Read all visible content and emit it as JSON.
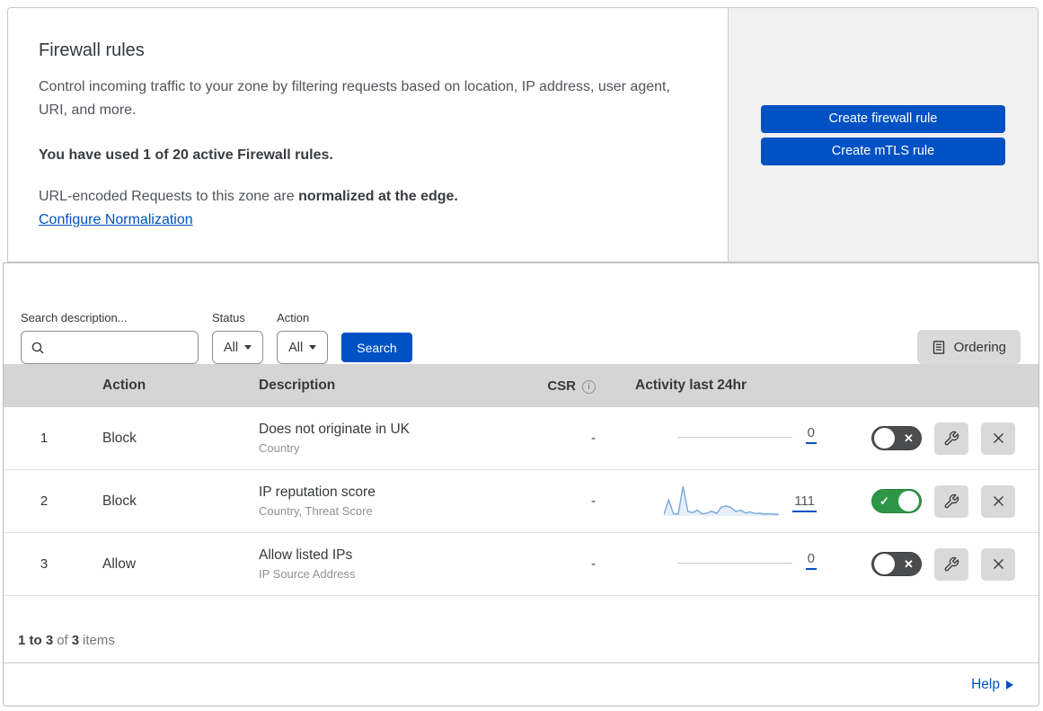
{
  "header": {
    "title": "Firewall rules",
    "description": "Control incoming traffic to your zone by filtering requests based on location, IP address, user agent, URI, and more.",
    "usage_note": "You have used 1 of 20 active Firewall rules.",
    "normalization_prefix": "URL-encoded Requests to this zone are ",
    "normalization_bold": "normalized at the edge.",
    "normalization_link": "Configure Normalization",
    "create_firewall_button": "Create firewall rule",
    "create_mtls_button": "Create mTLS rule"
  },
  "filters": {
    "search_label": "Search description...",
    "status_label": "Status",
    "status_value": "All",
    "action_label": "Action",
    "action_value": "All",
    "search_button": "Search",
    "ordering_button": "Ordering"
  },
  "table": {
    "headers": {
      "action": "Action",
      "description": "Description",
      "csr": "CSR",
      "activity": "Activity last 24hr"
    },
    "rows": [
      {
        "index": "1",
        "action": "Block",
        "title": "Does not originate in UK",
        "subtitle": "Country",
        "csr": "-",
        "activity_count": "0",
        "enabled": false
      },
      {
        "index": "2",
        "action": "Block",
        "title": "IP reputation score",
        "subtitle": "Country, Threat Score",
        "csr": "-",
        "activity_count": "111",
        "enabled": true
      },
      {
        "index": "3",
        "action": "Allow",
        "title": "Allow listed IPs",
        "subtitle": "IP Source Address",
        "csr": "-",
        "activity_count": "0",
        "enabled": false
      }
    ]
  },
  "chart_data": {
    "type": "line",
    "title": "Activity last 24hr sparkline for rule 2",
    "x_range": "last 24 hours",
    "values": [
      2,
      50,
      4,
      3,
      95,
      12,
      8,
      16,
      4,
      6,
      13,
      5,
      26,
      30,
      25,
      12,
      16,
      7,
      10,
      5,
      6,
      3,
      4,
      3,
      2
    ],
    "total_requests": 111,
    "flat_rows_value": 0,
    "line_color": "#74a7dc",
    "fill_color": "rgba(116,167,220,0.18)"
  },
  "icons": {
    "info_glyph": "i",
    "toggle_on_glyph": "✓",
    "toggle_off_glyph": "✕"
  },
  "footer": {
    "range": "1 to 3",
    "of": "of",
    "total": "3",
    "items": "items"
  },
  "help": {
    "label": "Help"
  },
  "colors": {
    "accent_blue": "#0051c3",
    "toggle_on_green": "#2e9647",
    "toggle_off_gray": "#4a4c4d",
    "panel_gray": "#f1f1f2",
    "table_header_gray": "#d5d5d5",
    "button_gray": "#d9d9d9"
  }
}
